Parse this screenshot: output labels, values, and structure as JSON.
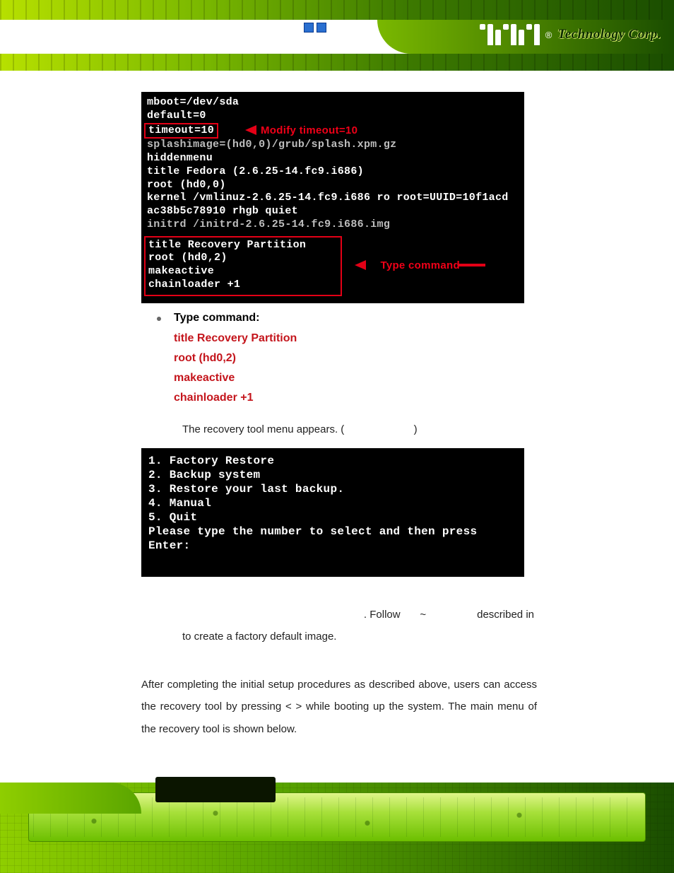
{
  "brand": {
    "registered": "®",
    "name": "Technology Corp."
  },
  "terminal1": {
    "l1": "mboot=/dev/sda",
    "l2": "default=0",
    "l3_box": "timeout=10",
    "l3_label": "Modify timeout=10",
    "l4": "splashimage=(hd0,0)/grub/splash.xpm.gz",
    "l5": "hiddenmenu",
    "l6": "title Fedora (2.6.25-14.fc9.i686)",
    "l7": "        root (hd0,0)",
    "l8": "        kernel /vmlinuz-2.6.25-14.fc9.i686 ro root=UUID=10f1acd",
    "l9": "ac38b5c78910 rhgb quiet",
    "l10": "        initrd /initrd-2.6.25-14.fc9.i686.img",
    "block": {
      "b1": "title   Recovery Partition",
      "b2": "root    (hd0,2)",
      "b3": "makeactive",
      "b4": "chainloader +1"
    },
    "block_label": "Type command"
  },
  "bullet": {
    "label": "Type command:",
    "cmds": {
      "c1": "title Recovery Partition",
      "c2": "root (hd0,2)",
      "c3": "makeactive",
      "c4": "chainloader +1"
    }
  },
  "line_tool_menu_a": "The recovery tool menu appears. (",
  "line_tool_menu_b": ")",
  "terminal2": {
    "l1": "1. Factory Restore",
    "l2": "2. Backup system",
    "l3": "3. Restore your last backup.",
    "l4": "4. Manual",
    "l5": "5. Quit",
    "l6": "Please type the number to select and then press Enter:"
  },
  "para1_a": ". Follow",
  "para1_b": "~",
  "para1_c": "described in",
  "para1_d": "to create a factory default image.",
  "para2": "After completing the initial setup procedures as described above, users can access the recovery tool by pressing <   > while booting up the system. The main menu of the recovery tool is shown below."
}
